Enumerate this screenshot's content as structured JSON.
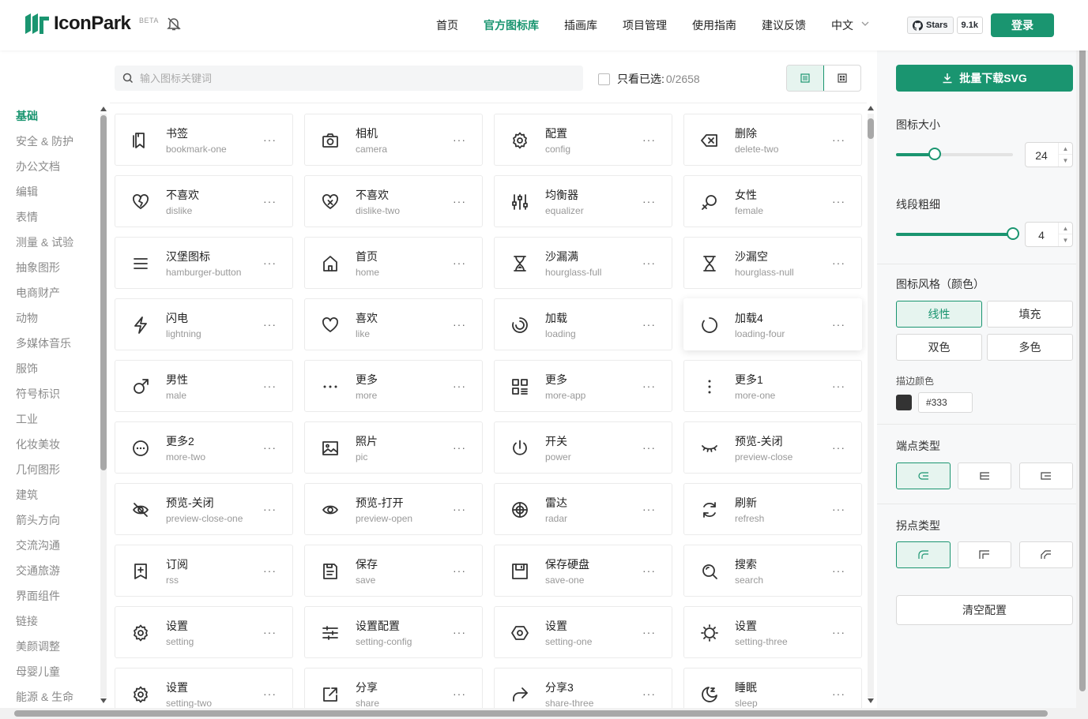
{
  "brand": {
    "name": "IconPark",
    "tag": "BETA"
  },
  "nav": [
    {
      "label": "首页",
      "active": false
    },
    {
      "label": "官方图标库",
      "active": true
    },
    {
      "label": "插画库",
      "active": false
    },
    {
      "label": "项目管理",
      "active": false
    },
    {
      "label": "使用指南",
      "active": false
    },
    {
      "label": "建议反馈",
      "active": false
    },
    {
      "label": "中文",
      "active": false
    }
  ],
  "github": {
    "label": "Stars",
    "count": "9.1k"
  },
  "login_label": "登录",
  "search": {
    "placeholder": "输入图标关键词",
    "value": ""
  },
  "only_selected": {
    "label": "只看已选:",
    "count": "0/2658",
    "checked": false
  },
  "categories": [
    "基础",
    "安全 & 防护",
    "办公文档",
    "编辑",
    "表情",
    "测量 & 试验",
    "抽象图形",
    "电商财产",
    "动物",
    "多媒体音乐",
    "服饰",
    "符号标识",
    "工业",
    "化妆美妆",
    "几何图形",
    "建筑",
    "箭头方向",
    "交流沟通",
    "交通旅游",
    "界面组件",
    "链接",
    "美颜调整",
    "母婴儿童",
    "能源 & 生命"
  ],
  "active_category": "基础",
  "icons": [
    {
      "zh": "书签",
      "en": "bookmark-one",
      "icon": "bookmark-icon"
    },
    {
      "zh": "相机",
      "en": "camera",
      "icon": "camera-icon"
    },
    {
      "zh": "配置",
      "en": "config",
      "icon": "gear-icon"
    },
    {
      "zh": "删除",
      "en": "delete-two",
      "icon": "delete-icon"
    },
    {
      "zh": "不喜欢",
      "en": "dislike",
      "icon": "dislike-icon"
    },
    {
      "zh": "不喜欢",
      "en": "dislike-two",
      "icon": "dislike-x-icon"
    },
    {
      "zh": "均衡器",
      "en": "equalizer",
      "icon": "equalizer-icon"
    },
    {
      "zh": "女性",
      "en": "female",
      "icon": "female-icon"
    },
    {
      "zh": "汉堡图标",
      "en": "hamburger-button",
      "icon": "hamburger-icon"
    },
    {
      "zh": "首页",
      "en": "home",
      "icon": "home-icon"
    },
    {
      "zh": "沙漏满",
      "en": "hourglass-full",
      "icon": "hourglass-full-icon"
    },
    {
      "zh": "沙漏空",
      "en": "hourglass-null",
      "icon": "hourglass-icon"
    },
    {
      "zh": "闪电",
      "en": "lightning",
      "icon": "lightning-icon"
    },
    {
      "zh": "喜欢",
      "en": "like",
      "icon": "heart-icon"
    },
    {
      "zh": "加载",
      "en": "loading",
      "icon": "loading-icon"
    },
    {
      "zh": "加载4",
      "en": "loading-four",
      "icon": "loading-arc-icon"
    },
    {
      "zh": "男性",
      "en": "male",
      "icon": "male-icon"
    },
    {
      "zh": "更多",
      "en": "more",
      "icon": "more-horizontal-icon"
    },
    {
      "zh": "更多",
      "en": "more-app",
      "icon": "more-app-icon"
    },
    {
      "zh": "更多1",
      "en": "more-one",
      "icon": "more-vertical-icon"
    },
    {
      "zh": "更多2",
      "en": "more-two",
      "icon": "more-circle-icon"
    },
    {
      "zh": "照片",
      "en": "pic",
      "icon": "picture-icon"
    },
    {
      "zh": "开关",
      "en": "power",
      "icon": "power-icon"
    },
    {
      "zh": "预览-关闭",
      "en": "preview-close",
      "icon": "eye-closed-icon"
    },
    {
      "zh": "预览-关闭",
      "en": "preview-close-one",
      "icon": "eye-off-icon"
    },
    {
      "zh": "预览-打开",
      "en": "preview-open",
      "icon": "eye-icon"
    },
    {
      "zh": "雷达",
      "en": "radar",
      "icon": "radar-icon"
    },
    {
      "zh": "刷新",
      "en": "refresh",
      "icon": "refresh-icon"
    },
    {
      "zh": "订阅",
      "en": "rss",
      "icon": "rss-icon"
    },
    {
      "zh": "保存",
      "en": "save",
      "icon": "save-icon"
    },
    {
      "zh": "保存硬盘",
      "en": "save-one",
      "icon": "save-disk-icon"
    },
    {
      "zh": "搜索",
      "en": "search",
      "icon": "search-icon"
    },
    {
      "zh": "设置",
      "en": "setting",
      "icon": "gear-icon"
    },
    {
      "zh": "设置配置",
      "en": "setting-config",
      "icon": "sliders-icon"
    },
    {
      "zh": "设置",
      "en": "setting-one",
      "icon": "hexagon-gear-icon"
    },
    {
      "zh": "设置",
      "en": "setting-three",
      "icon": "sun-gear-icon"
    },
    {
      "zh": "设置",
      "en": "setting-two",
      "icon": "gear-icon"
    },
    {
      "zh": "分享",
      "en": "share",
      "icon": "share-icon"
    },
    {
      "zh": "分享3",
      "en": "share-three",
      "icon": "share-arrow-icon"
    },
    {
      "zh": "睡眠",
      "en": "sleep",
      "icon": "moon-icon"
    }
  ],
  "panel": {
    "download_label": "批量下载SVG",
    "size": {
      "label": "图标大小",
      "value": "24",
      "fraction": 0.33
    },
    "stroke": {
      "label": "线段粗细",
      "value": "4",
      "fraction": 1.0
    },
    "style": {
      "label": "图标风格（颜色）",
      "options": [
        "线性",
        "填充",
        "双色",
        "多色"
      ],
      "selected": "线性"
    },
    "stroke_color": {
      "label": "描边颜色",
      "value": "#333"
    },
    "cap": {
      "label": "端点类型"
    },
    "join": {
      "label": "拐点类型"
    },
    "clear_label": "清空配置"
  },
  "colors": {
    "accent": "#1a9570",
    "text": "#333333",
    "muted": "#999999"
  }
}
